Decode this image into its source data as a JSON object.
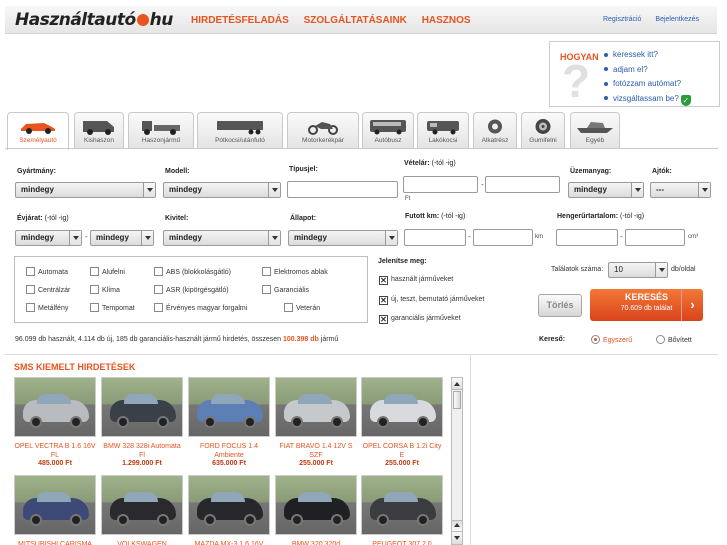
{
  "header": {
    "logo_main": "Használtautó",
    "logo_tail": "hu",
    "nav": [
      "HIRDETÉSFELADÁS",
      "SZOLGÁLTATÁSAINK",
      "HASZNOS"
    ],
    "register": "Regisztráció",
    "login": "Bejelentkezés"
  },
  "hogyan": {
    "title": "HOGYAN",
    "items": [
      "keressek itt?",
      "adjam el?",
      "fotózzam autómat?",
      "vizsgáltassam be?"
    ]
  },
  "tabs": [
    "Személyautó",
    "Kishaszon",
    "Haszonjármű",
    "Pótkocsi/utánfutó",
    "Motorkerékpár",
    "Autóbusz",
    "Lakókocsi",
    "Alkatrész",
    "Gumifelni",
    "Egyéb"
  ],
  "form": {
    "gyarto_label": "Gyártmány:",
    "gyarto_value": "mindegy",
    "modell_label": "Modell:",
    "modell_value": "mindegy",
    "tipusjel_label": "Típusjel:",
    "vetelar_label": "Vételár:",
    "vetelar_note": "(-tól -ig)",
    "ft_unit": "Ft",
    "uzemanyag_label": "Üzemanyag:",
    "uzemanyag_value": "mindegy",
    "ajtok_label": "Ajtók:",
    "ajtok_value": "---",
    "evjarat_label": "Évjárat:",
    "evjarat_note": "(-tól -ig)",
    "evjarat_from": "mindegy",
    "evjarat_to": "mindegy",
    "kivitel_label": "Kivitel:",
    "kivitel_value": "mindegy",
    "allapot_label": "Állapot:",
    "allapot_value": "mindegy",
    "km_label": "Futott km:",
    "km_note": "(-tól -ig)",
    "km_unit": "km",
    "henger_label": "Hengerűrtartalom:",
    "henger_note": "(-tól -ig)",
    "henger_unit": "cm³",
    "jelenitse_label": "Jelenítse meg:",
    "jelenitse": [
      "használt járműveket",
      "új, teszt, bemutató járműveket",
      "garanciális járműveket"
    ],
    "talalatok_label": "Találatok száma:",
    "talalatok_value": "10",
    "db_oldal": "db/oldal",
    "torles": "Törlés",
    "kereses": "KERESÉS",
    "kereses_count": "70.609 db találat",
    "kereso_label": "Kereső:",
    "kereso_options": [
      "Egyszerű",
      "Bővített"
    ]
  },
  "features": [
    [
      "Automata",
      "Alufelni",
      "ABS (blokkolásgátló)",
      "Elektromos ablak"
    ],
    [
      "Centrálzár",
      "Klíma",
      "ASR (kipörgésgátló)",
      "Garanciális"
    ],
    [
      "Metálfény",
      "Tempomat",
      "Érvényes magyar forgalmi",
      "Veterán"
    ]
  ],
  "stats": {
    "text": "96.099 db használt, 4.114 db új, 185 db garanciális-használt jármű hirdetés, összesen",
    "total": "100.398 db",
    "tail": "jármű"
  },
  "sms": {
    "title": "SMS KIEMELT HIRDETÉSEK",
    "row1": [
      {
        "name": "OPEL VECTRA B 1.6 16V FL",
        "price": "485.000 Ft",
        "color": "#b8bcc0"
      },
      {
        "name": "BMW 328 328i Automata Fl",
        "price": "1.299.000 Ft",
        "color": "#3a4048"
      },
      {
        "name": "FORD FOCUS 1.4 Ambiente",
        "price": "635.000 Ft",
        "color": "#5c7fb5"
      },
      {
        "name": "FIAT BRAVO 1.4 12V S SZF",
        "price": "255.000 Ft",
        "color": "#c6c9cc"
      },
      {
        "name": "OPEL CORSA B 1.2i City E",
        "price": "255.000 Ft",
        "color": "#d8dade"
      }
    ],
    "row2": [
      {
        "name": "MITSUBISHI CARISMA",
        "price": "",
        "color": "#3d4a78"
      },
      {
        "name": "VOLKSWAGEN",
        "price": "",
        "color": "#2a2a2e"
      },
      {
        "name": "MAZDA MX-3 1.6 16V",
        "price": "",
        "color": "#26282c"
      },
      {
        "name": "BMW 320 320d",
        "price": "",
        "color": "#1e2024"
      },
      {
        "name": "PEUGEOT 307 2.0",
        "price": "",
        "color": "#3a3c40"
      }
    ]
  }
}
